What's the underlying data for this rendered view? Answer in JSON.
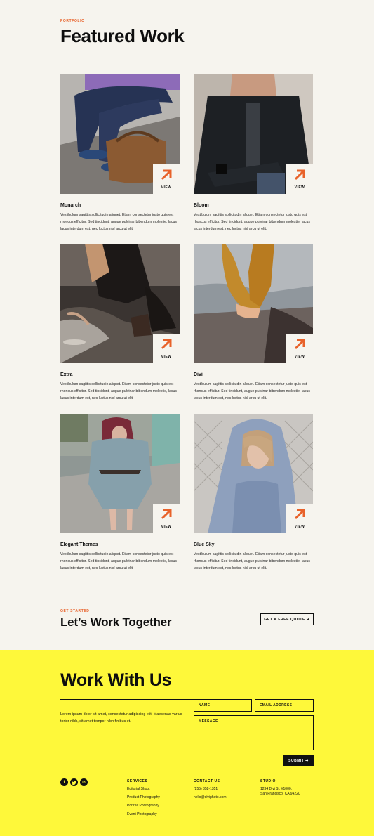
{
  "portfolio": {
    "eyebrow": "PORTFOLIO",
    "title": "Featured Work",
    "view_label": "VIEW",
    "items": [
      {
        "title": "Monarch",
        "desc": "Vestibulum sagittis sollicitudin aliquet. Etiam consectetur justo quis est rhoncus efficitur. Sed tincidunt, augue pulvinar bibendum molestie, lacus lacus interdum est, nec luctus nisl arcu ut elit."
      },
      {
        "title": "Bloom",
        "desc": "Vestibulum sagittis sollicitudin aliquet. Etiam consectetur justo quis est rhoncus efficitur. Sed tincidunt, augue pulvinar bibendum molestie, lacus lacus interdum est, nec luctus nisl arcu ut elit."
      },
      {
        "title": "Extra",
        "desc": "Vestibulum sagittis sollicitudin aliquet. Etiam consectetur justo quis est rhoncus efficitur. Sed tincidunt, augue pulvinar bibendum molestie, lacus lacus interdum est, nec luctus nisl arcu ut elit."
      },
      {
        "title": "Divi",
        "desc": "Vestibulum sagittis sollicitudin aliquet. Etiam consectetur justo quis est rhoncus efficitur. Sed tincidunt, augue pulvinar bibendum molestie, lacus lacus interdum est, nec luctus nisl arcu ut elit."
      },
      {
        "title": "Elegant Themes",
        "desc": "Vestibulum sagittis sollicitudin aliquet. Etiam consectetur justo quis est rhoncus efficitur. Sed tincidunt, augue pulvinar bibendum molestie, lacus lacus interdum est, nec luctus nisl arcu ut elit."
      },
      {
        "title": "Blue Sky",
        "desc": "Vestibulum sagittis sollicitudin aliquet. Etiam consectetur justo quis est rhoncus efficitur. Sed tincidunt, augue pulvinar bibendum molestie, lacus lacus interdum est, nec luctus nisl arcu ut elit."
      }
    ]
  },
  "cta": {
    "eyebrow": "GET STARTED",
    "title": "Let’s Work Together",
    "button_label": "GET A FREE QUOTE ➔"
  },
  "contact": {
    "title": "Work With Us",
    "intro": "Lorem ipsum dolor sit amet, consectetur adipiscing elit. Maecenas varius tortor nibh, sit amet tempor nibh finibus et.",
    "name_placeholder": "NAME",
    "email_placeholder": "EMAIL ADDRESS",
    "message_placeholder": "MESSAGE",
    "submit_label": "SUBMIT ➔"
  },
  "footer": {
    "social_icons": [
      "facebook-icon",
      "twitter-icon",
      "linkedin-icon"
    ],
    "services": {
      "title": "SERVICES",
      "items": [
        "Editorial Shoot",
        "Product Photography",
        "Portrait Photography",
        "Event Photography"
      ]
    },
    "contact": {
      "title": "CONTACT US",
      "phone": "(255) 352-1351",
      "email": "hello@diviphoto.com"
    },
    "studio": {
      "title": "STUDIO",
      "address_line1": "1234 Divi St. #1000,",
      "address_line2": "San Francisco, CA 94220"
    }
  },
  "colors": {
    "accent": "#e8622a",
    "background": "#f6f4ee",
    "footer_background": "#fef83a",
    "text": "#111111"
  }
}
